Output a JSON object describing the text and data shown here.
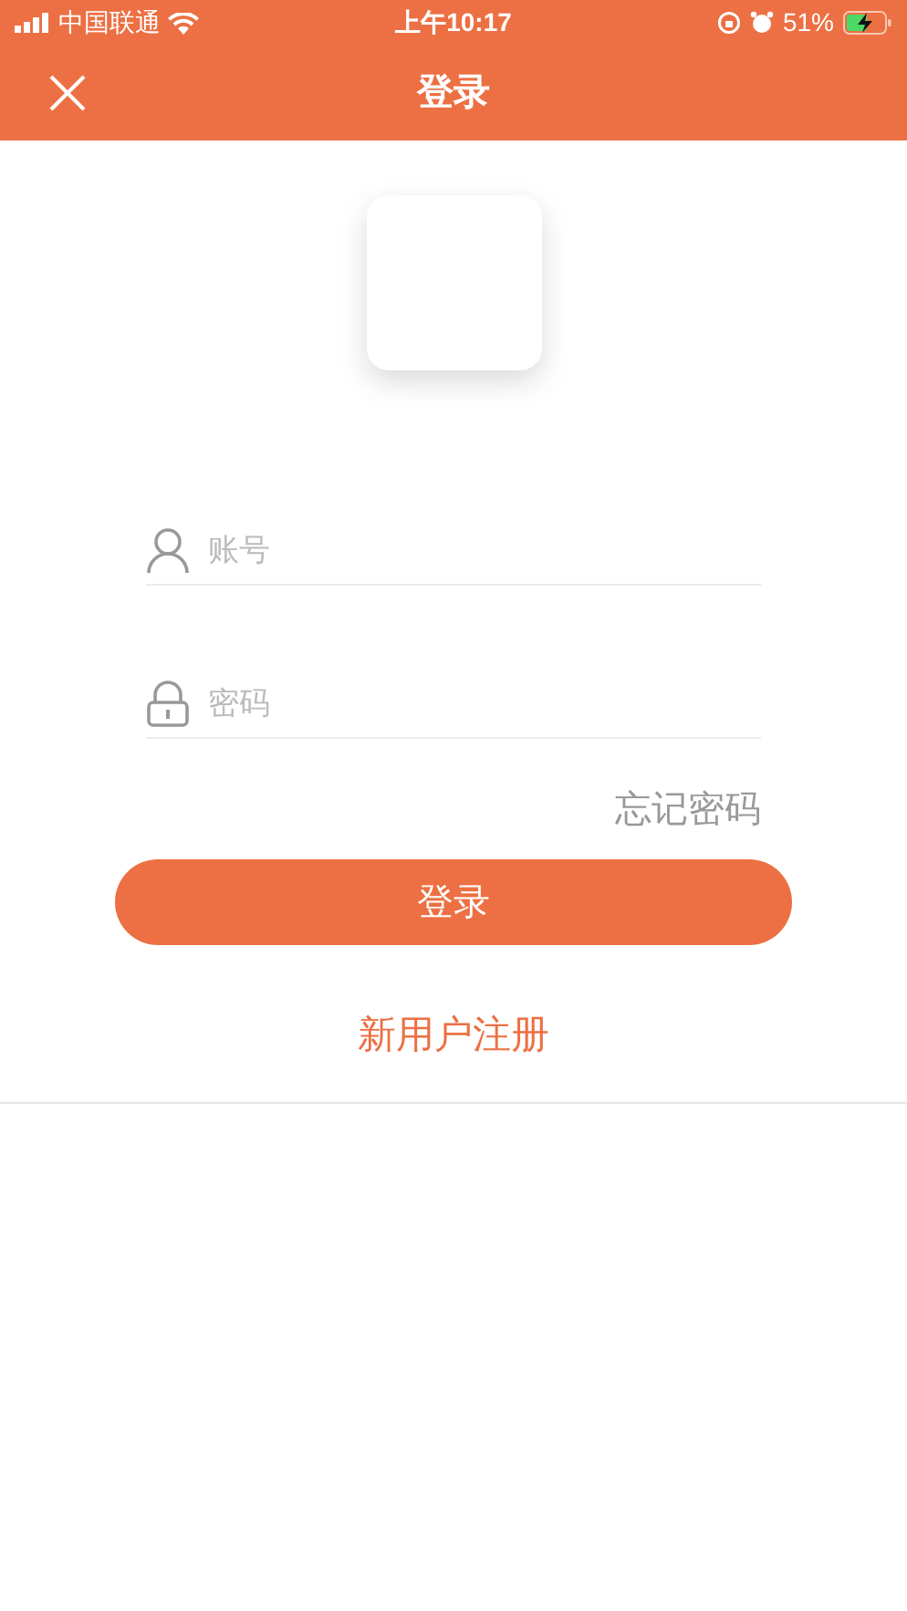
{
  "status_bar": {
    "carrier": "中国联通",
    "time": "上午10:17",
    "battery": "51%"
  },
  "nav": {
    "title": "登录"
  },
  "form": {
    "account": {
      "placeholder": "账号"
    },
    "password": {
      "placeholder": "密码"
    },
    "forgot": "忘记密码",
    "login": "登录",
    "register": "新用户注册"
  }
}
